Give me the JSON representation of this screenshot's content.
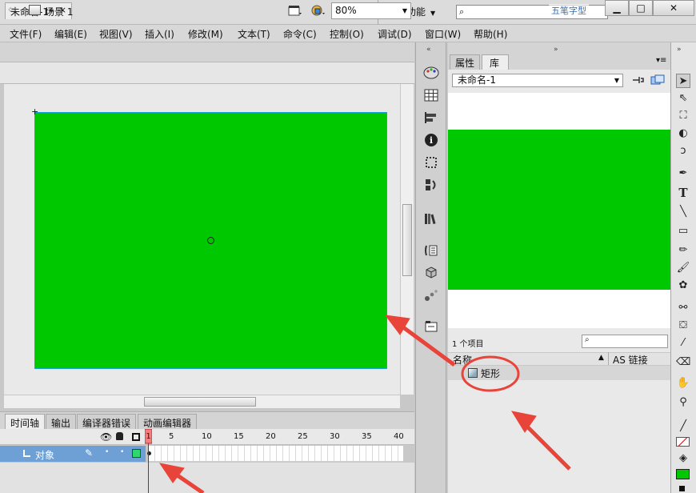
{
  "app": {
    "logo": "Fl",
    "workspace": "基本功能",
    "watermark": "五笔字型"
  },
  "menu": [
    "文件(F)",
    "编辑(E)",
    "视图(V)",
    "插入(I)",
    "修改(M)",
    "文本(T)",
    "命令(C)",
    "控制(O)",
    "调试(D)",
    "窗口(W)",
    "帮助(H)"
  ],
  "document": {
    "tab_label": "未命名-1*",
    "close": "×",
    "scene_label": "场景 1",
    "zoom": "80%"
  },
  "timeline": {
    "tabs": [
      "时间轴",
      "输出",
      "编译器错误",
      "动画编辑器"
    ],
    "layer_name": "对象",
    "frame_numbers": [
      "1",
      "5",
      "10",
      "15",
      "20",
      "25",
      "30",
      "35",
      "40"
    ],
    "current_frame": 1
  },
  "panel": {
    "tabs": [
      "属性",
      "库"
    ],
    "document_select": "未命名-1",
    "item_count": "1 个项目",
    "column_name": "名称",
    "column_linkage": "AS 链接",
    "items": [
      {
        "name": "矩形"
      }
    ]
  },
  "colors": {
    "stage_fill": "#00c800",
    "annotation": "#e8443a",
    "layer_highlight": "#6ea0d6"
  },
  "tools": [
    "selection-tool",
    "subselection-tool",
    "free-transform-tool",
    "3d-rotation-tool",
    "lasso-tool",
    "pen-tool",
    "text-tool",
    "line-tool",
    "rectangle-tool",
    "pencil-tool",
    "brush-tool",
    "deco-tool",
    "bone-tool",
    "paint-bucket-tool",
    "eyedropper-tool",
    "eraser-tool",
    "hand-tool",
    "zoom-tool"
  ]
}
